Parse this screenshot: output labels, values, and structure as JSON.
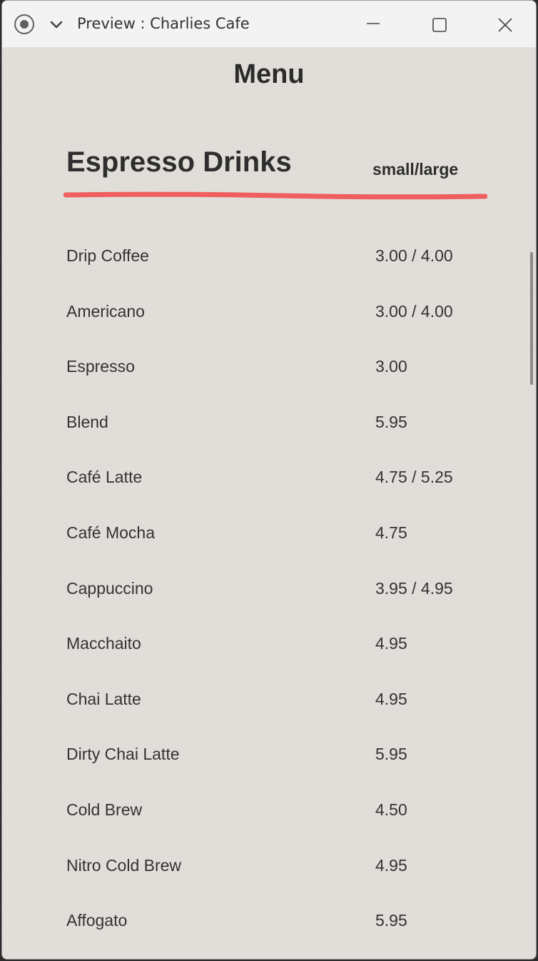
{
  "window": {
    "title": "Preview : Charlies Cafe"
  },
  "icons": {
    "record": "record-icon",
    "chevron": "chevron-down-icon",
    "minimize": "minimize-icon",
    "maximize": "maximize-icon",
    "close": "close-icon"
  },
  "colors": {
    "background": "#e1ded9",
    "accent_underline": "#ef5f5f",
    "text": "#2d2d2d"
  },
  "menu": {
    "title": "Menu",
    "section": {
      "title": "Espresso Drinks",
      "size_header": "small/large",
      "items": [
        {
          "name": "Drip Coffee",
          "price": "3.00 / 4.00"
        },
        {
          "name": "Americano",
          "price": "3.00 / 4.00"
        },
        {
          "name": "Espresso",
          "price": "3.00"
        },
        {
          "name": "Blend",
          "price": "5.95"
        },
        {
          "name": "Café Latte",
          "price": "4.75 / 5.25"
        },
        {
          "name": "Café Mocha",
          "price": "4.75"
        },
        {
          "name": "Cappuccino",
          "price": "3.95 / 4.95"
        },
        {
          "name": "Macchaito",
          "price": "4.95"
        },
        {
          "name": "Chai Latte",
          "price": "4.95"
        },
        {
          "name": "Dirty Chai Latte",
          "price": "5.95"
        },
        {
          "name": "Cold Brew",
          "price": "4.50"
        },
        {
          "name": "Nitro Cold Brew",
          "price": "4.95"
        },
        {
          "name": "Affogato",
          "price": "5.95"
        }
      ]
    }
  }
}
